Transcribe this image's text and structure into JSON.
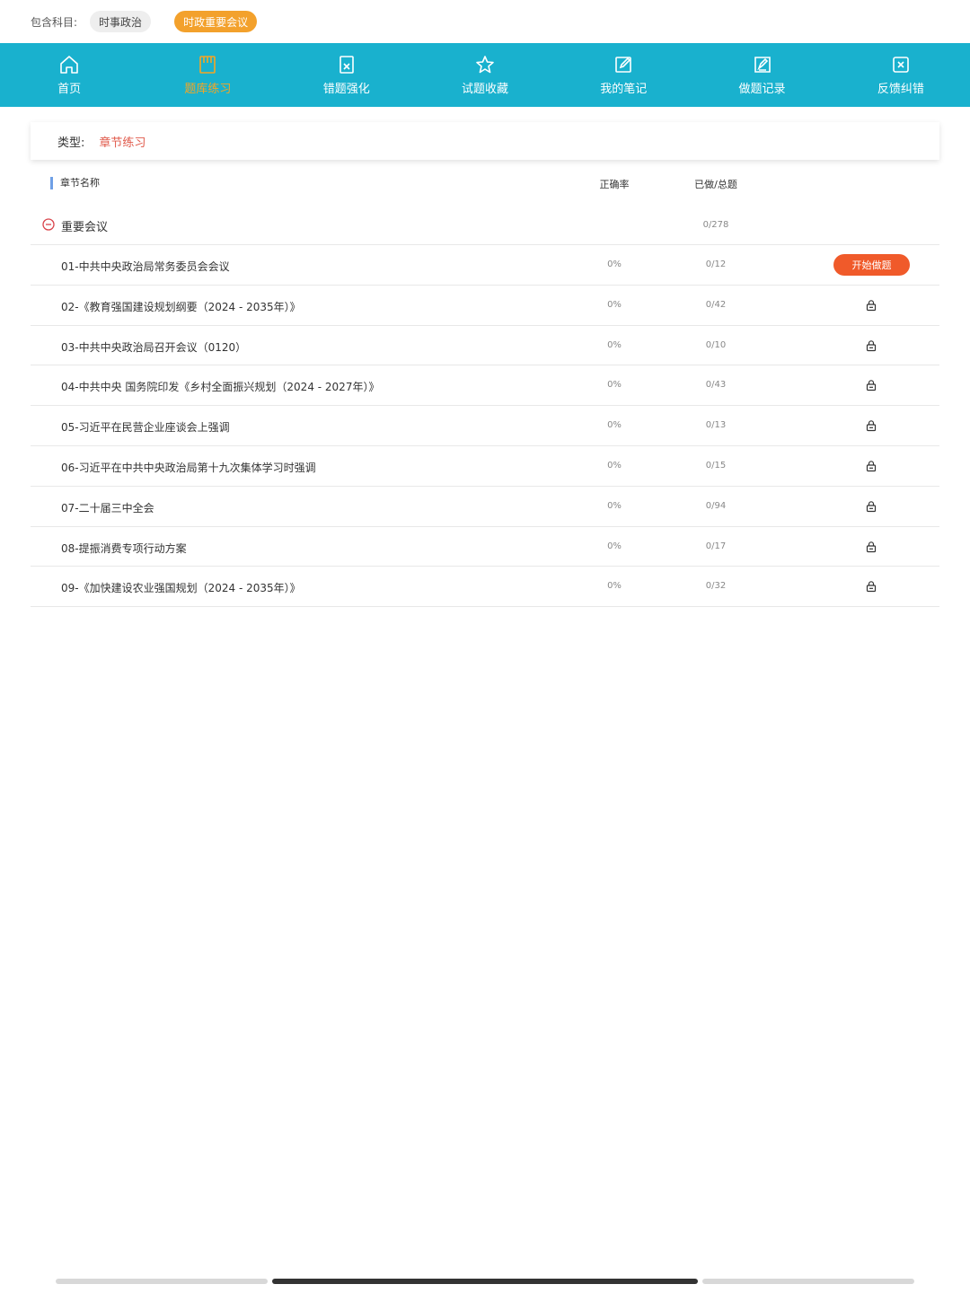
{
  "subjects": {
    "label": "包含科目:",
    "chips": [
      {
        "label": "时事政治",
        "active": false
      },
      {
        "label": "时政重要会议",
        "active": true
      }
    ]
  },
  "nav": [
    {
      "label": "首页",
      "icon": "home-icon",
      "active": false
    },
    {
      "label": "题库练习",
      "icon": "book-icon",
      "active": true
    },
    {
      "label": "错题强化",
      "icon": "wrong-book-icon",
      "active": false
    },
    {
      "label": "试题收藏",
      "icon": "star-icon",
      "active": false
    },
    {
      "label": "我的笔记",
      "icon": "edit-note-icon",
      "active": false
    },
    {
      "label": "做题记录",
      "icon": "record-icon",
      "active": false
    },
    {
      "label": "反馈纠错",
      "icon": "feedback-icon",
      "active": false
    }
  ],
  "type": {
    "label": "类型:",
    "value": "章节练习"
  },
  "table": {
    "headers": {
      "name": "章节名称",
      "rate": "正确率",
      "done": "已做/总题"
    },
    "group": {
      "name": "重要会议",
      "count": "0/278"
    },
    "start_label": "开始做题",
    "rows": [
      {
        "name": "01-中共中央政治局常务委员会会议",
        "rate": "0%",
        "done": "0/12",
        "locked": false
      },
      {
        "name": "02-《教育强国建设规划纲要（2024 - 2035年）》",
        "rate": "0%",
        "done": "0/42",
        "locked": true
      },
      {
        "name": "03-中共中央政治局召开会议（0120）",
        "rate": "0%",
        "done": "0/10",
        "locked": true
      },
      {
        "name": "04-中共中央 国务院印发《乡村全面振兴规划（2024 - 2027年）》",
        "rate": "0%",
        "done": "0/43",
        "locked": true
      },
      {
        "name": "05-习近平在民营企业座谈会上强调",
        "rate": "0%",
        "done": "0/13",
        "locked": true
      },
      {
        "name": "06-习近平在中共中央政治局第十九次集体学习时强调",
        "rate": "0%",
        "done": "0/15",
        "locked": true
      },
      {
        "name": "07-二十届三中全会",
        "rate": "0%",
        "done": "0/94",
        "locked": true
      },
      {
        "name": "08-提振消费专项行动方案",
        "rate": "0%",
        "done": "0/17",
        "locked": true
      },
      {
        "name": "09-《加快建设农业强国规划（2024 - 2035年）》",
        "rate": "0%",
        "done": "0/32",
        "locked": true
      }
    ]
  }
}
